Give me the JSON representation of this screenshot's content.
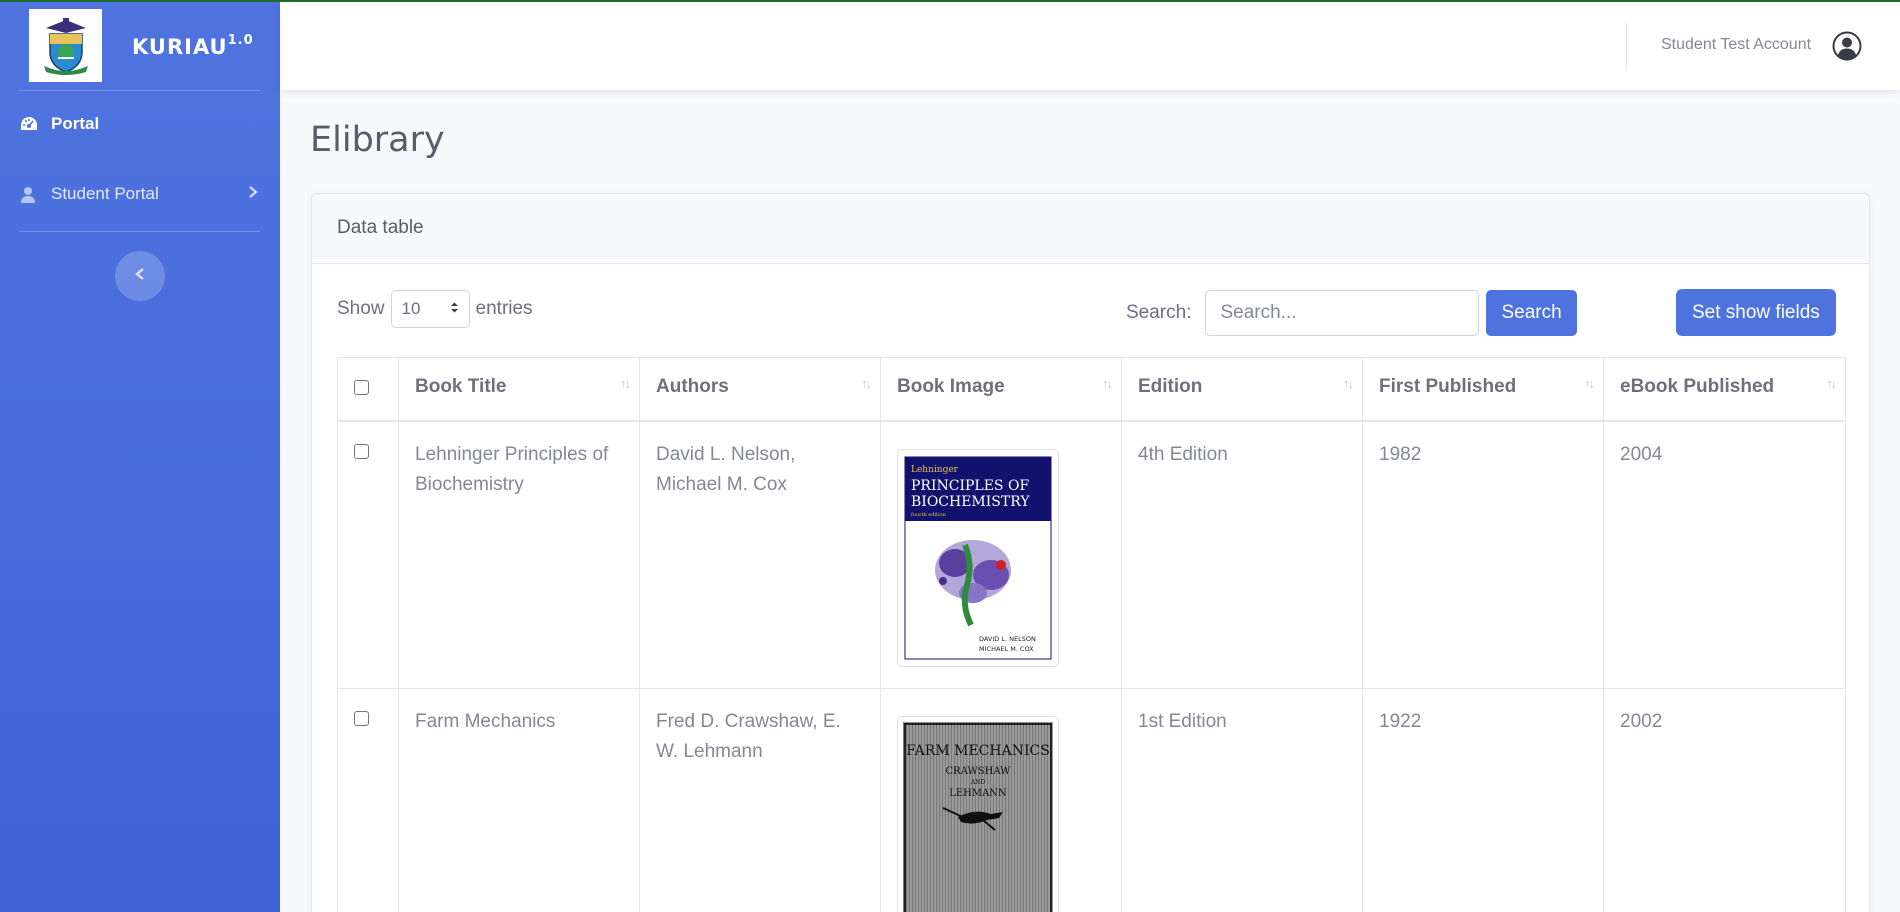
{
  "brand": {
    "name": "KURIAU",
    "version": "1.0"
  },
  "sidebar": {
    "items": [
      {
        "label": "Portal",
        "icon": "dashboard-gauge-icon"
      },
      {
        "label": "Student Portal",
        "icon": "user-icon"
      }
    ],
    "toggle_icon": "chevron-left-icon"
  },
  "topbar": {
    "user_name": "Student Test Account",
    "avatar_icon": "user-circle-icon"
  },
  "page": {
    "title": "Elibrary"
  },
  "card": {
    "header": "Data table"
  },
  "controls": {
    "show_label": "Show",
    "entries_value": "10",
    "entries_label": "entries",
    "search_label": "Search:",
    "search_placeholder": "Search...",
    "search_button": "Search",
    "fields_button": "Set show fields"
  },
  "table": {
    "columns": [
      "Book Title",
      "Authors",
      "Book Image",
      "Edition",
      "First Published",
      "eBook Published"
    ],
    "rows": [
      {
        "title": "Lehninger Principles of Biochemistry",
        "authors": "David L. Nelson, Michael M. Cox",
        "cover_top": "Lehninger",
        "cover_title_1": "PRINCIPLES OF",
        "cover_title_2": "BIOCHEMISTRY",
        "cover_edition": "fourth edition",
        "cover_author_1": "DAVID L. NELSON",
        "cover_author_2": "MICHAEL M. COX",
        "edition": "4th Edition",
        "first_published": "1982",
        "ebook_published": "2004"
      },
      {
        "title": "Farm Mechanics",
        "authors": "Fred D. Crawshaw, E. W. Lehmann",
        "cover_title": "FARM MECHANICS",
        "cover_author_1": "CRAWSHAW",
        "cover_and": "AND",
        "cover_author_2": "LEHMANN",
        "edition": "1st Edition",
        "first_published": "1922",
        "ebook_published": "2002"
      }
    ]
  },
  "colors": {
    "sidebar": "#4e73df",
    "primary_button": "#4e73df",
    "top_line": "#1e6b2e"
  }
}
